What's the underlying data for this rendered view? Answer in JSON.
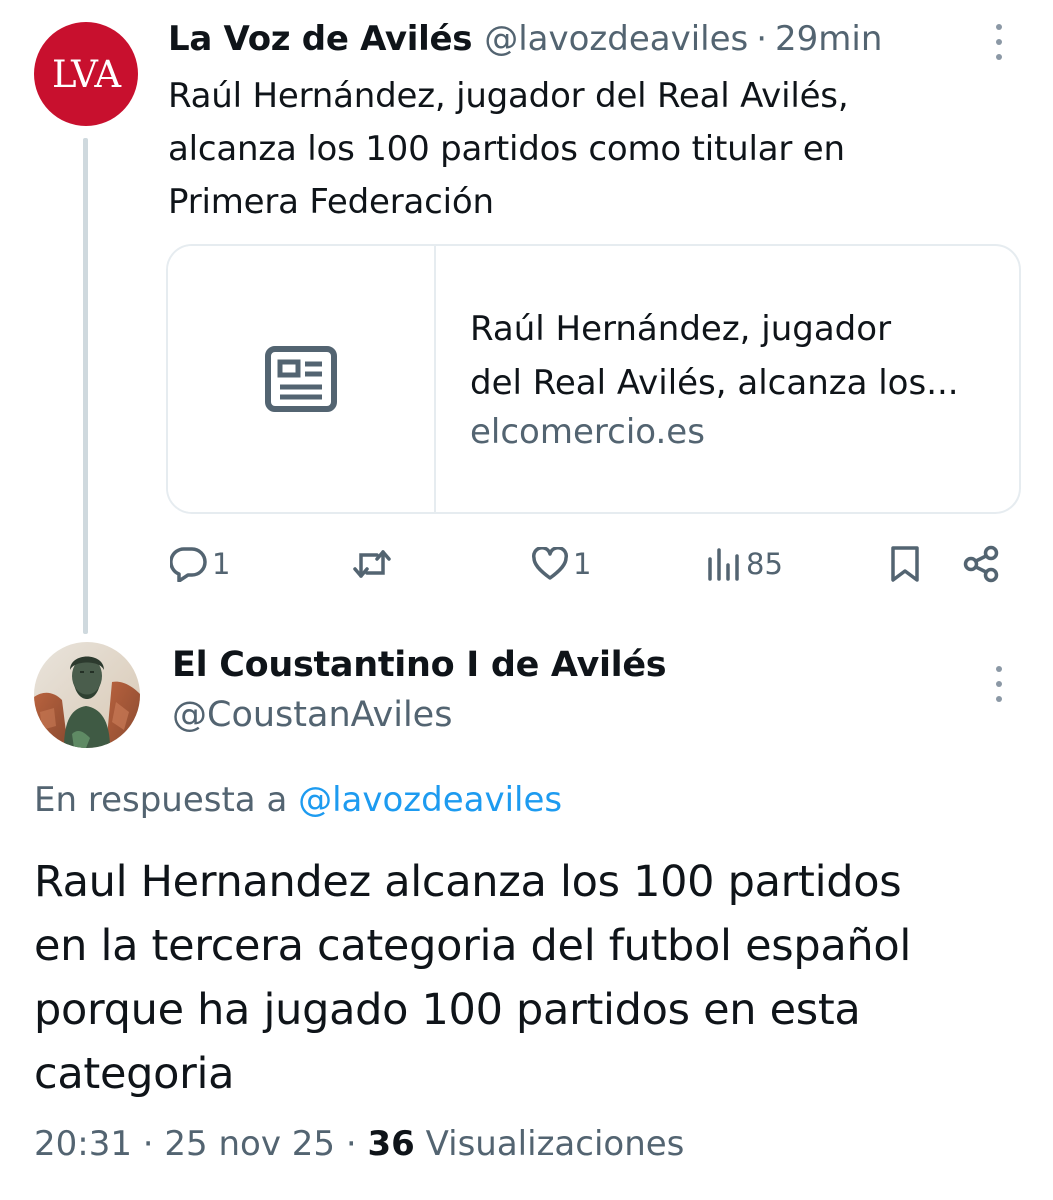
{
  "tweet1": {
    "avatar_text": "LVA",
    "name": "La Voz de Avilés",
    "handle": "@lavozdeaviles",
    "separator": "·",
    "time": "29min",
    "text": "Raúl Hernández, jugador del Real Avilés, alcanza los 100 partidos como titular en Primera Federación",
    "text_lines": [
      "Raúl Hernández, jugador del Real Avilés,",
      "alcanza los 100 partidos como titular en",
      "Primera Federación"
    ],
    "card": {
      "thumb_icon": "news-article-icon",
      "title_lines": [
        "Raúl Hernández, jugador",
        "del Real Avilés, alcanza los..."
      ],
      "domain": "elcomercio.es"
    },
    "actions": {
      "replies": "1",
      "retweets": "",
      "likes": "1",
      "views": "85"
    }
  },
  "tweet2": {
    "name": "El Coustantino I de Avilés",
    "handle": "@CoustanAviles",
    "reply_prefix": "En respuesta a",
    "reply_mention": "@lavozdeaviles",
    "text_lines": [
      "Raul Hernandez alcanza los 100 partidos",
      "en la tercera categoria del futbol español",
      "porque ha jugado 100 partidos en esta",
      "categoria"
    ],
    "meta": {
      "time": "20:31",
      "separator": "·",
      "date": "25 nov 25",
      "views_count": "36",
      "views_label": "Visualizaciones"
    }
  },
  "colors": {
    "text": "#0f1419",
    "secondary": "#536471",
    "link": "#1d9bf0",
    "lva_red": "#c8102e",
    "border": "#e6ecf0",
    "thread_line": "#cfd9de"
  }
}
